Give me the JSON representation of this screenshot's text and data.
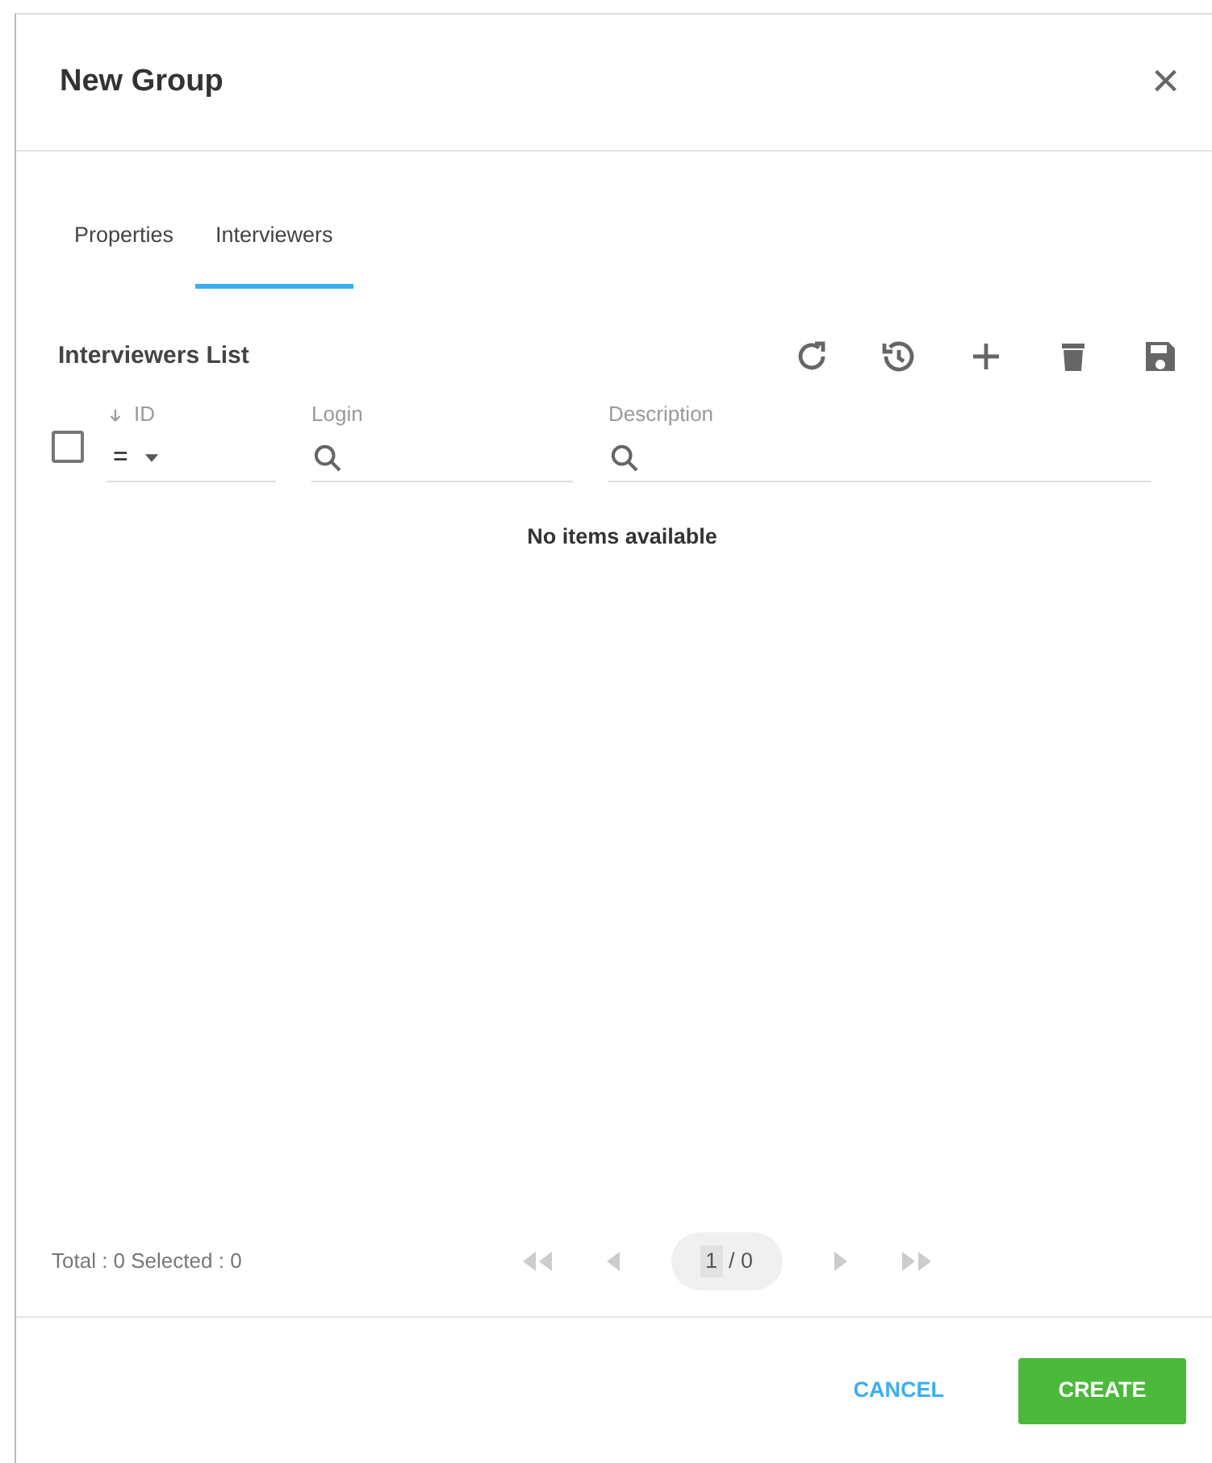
{
  "dialog": {
    "title": "New Group",
    "close": "×"
  },
  "tabs": [
    {
      "label": "Properties",
      "selected": false
    },
    {
      "label": "Interviewers",
      "selected": true
    }
  ],
  "list": {
    "title": "Interviewers List",
    "toolbar": [
      {
        "kind": "refresh"
      },
      {
        "kind": "history"
      },
      {
        "kind": "add"
      },
      {
        "kind": "delete"
      },
      {
        "kind": "save"
      }
    ],
    "select_all": {
      "checked": false
    },
    "columns": [
      {
        "label": "ID",
        "kind": "number",
        "sorted": true,
        "operator": "="
      },
      {
        "label": "Login",
        "kind": "search"
      },
      {
        "label": "Description",
        "kind": "search"
      }
    ],
    "empty_message": "No items available"
  },
  "footer": {
    "summary": "Total : 0 Selected : 0",
    "page": "1",
    "page_of": "/ 0"
  },
  "buttons": [
    {
      "label": "CANCEL",
      "kind": "text"
    },
    {
      "label": "CREATE",
      "kind": "primary"
    }
  ]
}
